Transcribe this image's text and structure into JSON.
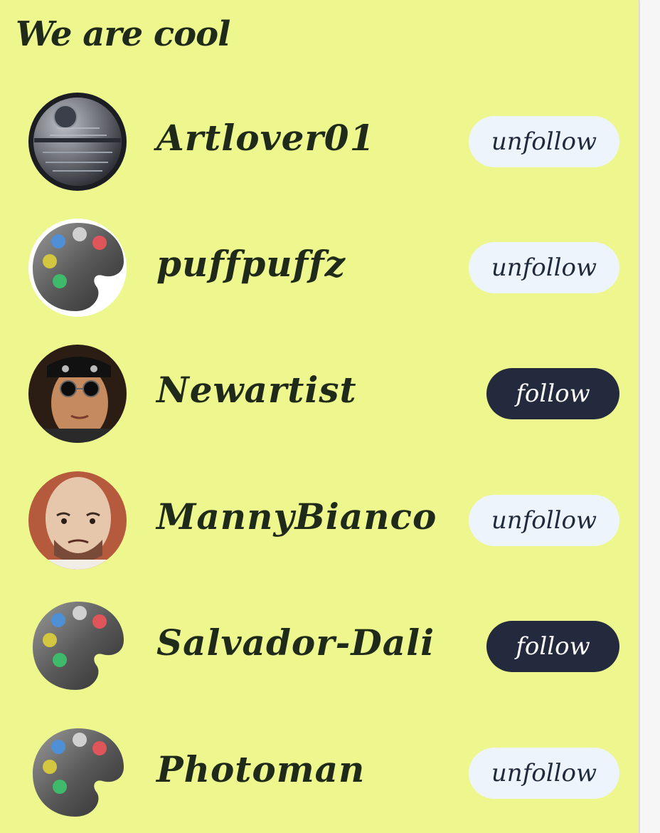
{
  "panel": {
    "title": "We are cool"
  },
  "users": [
    {
      "name": "Artlover01",
      "button": "unfollow",
      "following": true,
      "avatar": "death-star-avatar"
    },
    {
      "name": "puffpuffz",
      "button": "unfollow",
      "following": true,
      "avatar": "palette-avatar"
    },
    {
      "name": "Newartist",
      "button": "follow",
      "following": false,
      "avatar": "man-sunglasses-avatar"
    },
    {
      "name": "MannyBianco",
      "button": "unfollow",
      "following": true,
      "avatar": "bald-man-avatar"
    },
    {
      "name": "Salvador-Dali",
      "button": "follow",
      "following": false,
      "avatar": "palette-avatar"
    },
    {
      "name": "Photoman",
      "button": "unfollow",
      "following": true,
      "avatar": "palette-avatar"
    }
  ],
  "colors": {
    "panel_bg": "#eef78d",
    "unfollow_bg": "#eef4fb",
    "follow_bg": "#242a3d",
    "text": "#1f2a1a"
  }
}
